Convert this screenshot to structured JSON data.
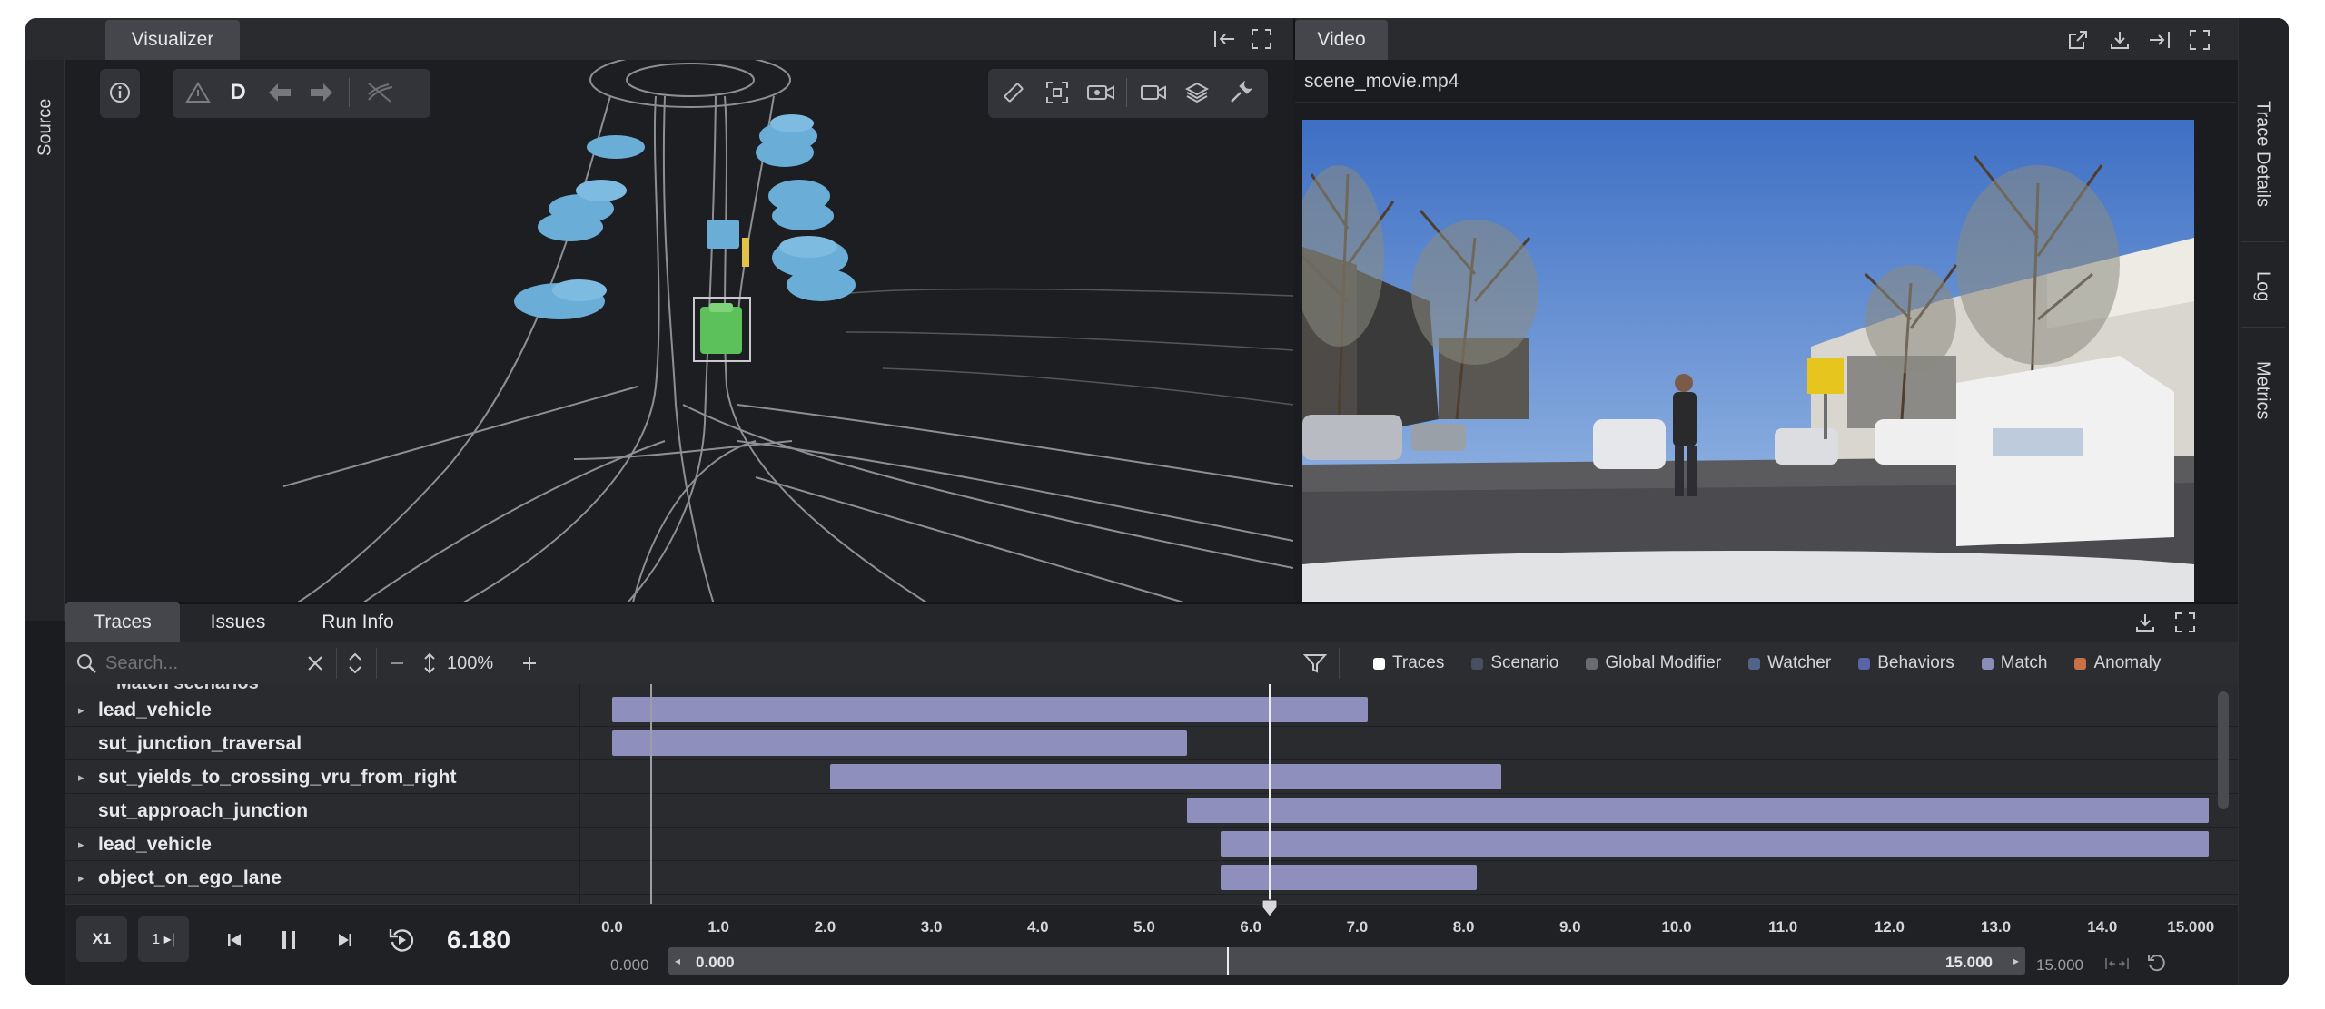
{
  "visualizer": {
    "tab_label": "Visualizer",
    "source_label": "Source",
    "drive_mode_label": "D"
  },
  "video": {
    "tab_label": "Video",
    "filename": "scene_movie.mp4"
  },
  "right_rail": {
    "items": [
      "Trace Details",
      "Log",
      "Metrics"
    ]
  },
  "bottom_tabs": [
    "Traces",
    "Issues",
    "Run Info"
  ],
  "traces_toolbar": {
    "search_placeholder": "Search...",
    "zoom": "100%",
    "legend": [
      {
        "label": "Traces",
        "color": "#ffffff"
      },
      {
        "label": "Scenario",
        "color": "#4a4e62"
      },
      {
        "label": "Global Modifier",
        "color": "#6a6b70"
      },
      {
        "label": "Watcher",
        "color": "#4f6488"
      },
      {
        "label": "Behaviors",
        "color": "#5864a8"
      },
      {
        "label": "Match",
        "color": "#8b8db8"
      },
      {
        "label": "Anomaly",
        "color": "#c8704a"
      }
    ]
  },
  "trace_section_label": "Match scenarios",
  "trace_rows": [
    {
      "label": "lead_vehicle",
      "expandable": true,
      "start": 0.0,
      "end": 7.1
    },
    {
      "label": "sut_junction_traversal",
      "expandable": false,
      "start": 0.0,
      "end": 5.4
    },
    {
      "label": "sut_yields_to_crossing_vru_from_right",
      "expandable": true,
      "start": 2.05,
      "end": 8.35
    },
    {
      "label": "sut_approach_junction",
      "expandable": false,
      "start": 5.4,
      "end": 15.0
    },
    {
      "label": "lead_vehicle",
      "expandable": true,
      "start": 5.72,
      "end": 15.0
    },
    {
      "label": "object_on_ego_lane",
      "expandable": true,
      "start": 5.72,
      "end": 8.12
    }
  ],
  "timeline": {
    "ticks": [
      "0.0",
      "1.0",
      "2.0",
      "3.0",
      "4.0",
      "5.0",
      "6.0",
      "7.0",
      "8.0",
      "9.0",
      "10.0",
      "11.0",
      "12.0",
      "13.0",
      "14.0",
      "15.000"
    ],
    "min": 0,
    "max": 15,
    "cursor": 6.18,
    "range_start_outer": "0.000",
    "range_start_inner": "0.000",
    "range_end_inner": "15.000",
    "range_end_outer": "15.000"
  },
  "playback": {
    "speed_label": "X1",
    "step_label": "1 ▸|",
    "current_time": "6.180"
  },
  "colors": {
    "match_bar": "#8e8fbc",
    "background": "#1b1c1f",
    "ego_vehicle": "#5cc15a",
    "other_vehicle": "#6aaed8"
  },
  "icons": [
    "info-icon",
    "warning-icon",
    "arrow-left-icon",
    "arrow-right-icon",
    "road-off-icon",
    "ruler-icon",
    "focus-icon",
    "camera-follow-icon",
    "video-camera-icon",
    "layers-icon",
    "wrench-icon",
    "collapse-icon",
    "fullscreen-icon",
    "external-link-icon",
    "download-icon",
    "dock-right-icon",
    "search-icon",
    "clear-icon",
    "expand-collapse-icon",
    "filter-icon",
    "skip-start-icon",
    "pause-icon",
    "skip-end-icon",
    "replay-icon",
    "reset-icon"
  ]
}
